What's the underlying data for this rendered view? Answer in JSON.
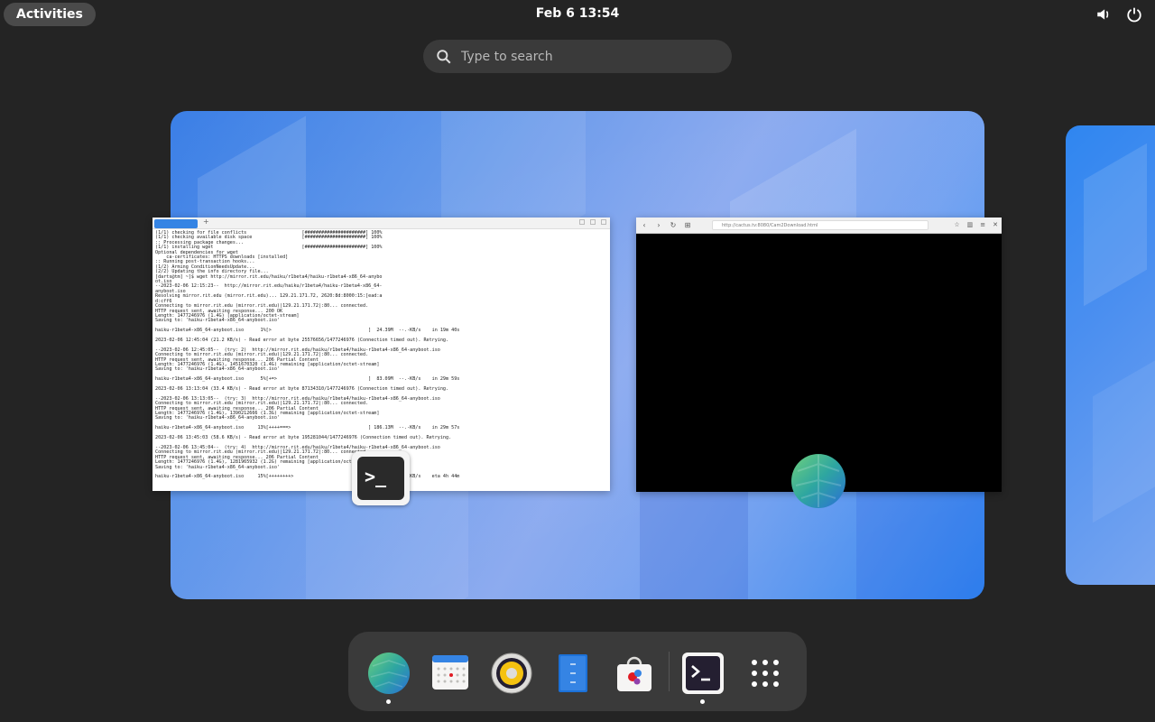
{
  "topbar": {
    "activities_label": "Activities",
    "clock": "Feb 6  13:54",
    "volume_icon": "volume-icon",
    "power_icon": "power-icon"
  },
  "search": {
    "placeholder": "Type to search"
  },
  "terminal_window": {
    "app_icon": "terminal-icon",
    "lines": [
      "(1/1) checking for file conflicts                    [######################] 100%",
      "(1/1) checking available disk space                  [######################] 100%",
      ":: Processing package changes...",
      "(1/1) installing wget                                [######################] 100%",
      "Optional dependencies for wget",
      "    ca-certificates: HTTPS downloads [installed]",
      ":: Running post-transaction hooks...",
      "(1/2) Arming ConditionNeedsUpdate...",
      "(2/2) Updating the info directory file...",
      "[darts@tm] ~]$ wget http://mirror.rit.edu/haiku/r1beta4/haiku-r1beta4-x86_64-anybo",
      "ot.iso",
      "--2023-02-06 12:15:23--  http://mirror.rit.edu/haiku/r1beta4/haiku-r1beta4-x86_64-",
      "anyboot.iso",
      "Resolving mirror.rit.edu (mirror.rit.edu)... 129.21.171.72, 2620:8d:8000:15:[ead:a",
      "d:cff6",
      "Connecting to mirror.rit.edu (mirror.rit.edu)|129.21.171.72|:80... connected.",
      "HTTP request sent, awaiting response... 200 OK",
      "Length: 1477246976 (1.4G) [application/octet-stream]",
      "Saving to: 'haiku-r1beta4-x86_64-anyboot.iso'",
      "",
      "haiku-r1beta4-x86_64-anyboot.iso      1%[>                                   ]  24.39M  --.-KB/s    in 19m 40s",
      "",
      "2023-02-06 12:45:04 (21.2 KB/s) - Read error at byte 25576656/1477246976 (Connection timed out). Retrying.",
      "",
      "--2023-02-06 12:45:05--  (try: 2)  http://mirror.rit.edu/haiku/r1beta4/haiku-r1beta4-x86_64-anyboot.iso",
      "Connecting to mirror.rit.edu (mirror.rit.edu)|129.21.171.72|:80... connected.",
      "HTTP request sent, awaiting response... 206 Partial Content",
      "Length: 1477246976 (1.4G), 1451670320 (1.4G) remaining [application/octet-stream]",
      "Saving to: 'haiku-r1beta4-x86_64-anyboot.iso'",
      "",
      "haiku-r1beta4-x86_64-anyboot.iso      5%[+=>                                 ]  83.09M  --.-KB/s    in 29m 59s",
      "",
      "2023-02-06 13:13:04 (33.4 KB/s) - Read error at byte 87134310/1477246976 (Connection timed out). Retrying.",
      "",
      "--2023-02-06 13:13:05--  (try: 3)  http://mirror.rit.edu/haiku/r1beta4/haiku-r1beta4-x86_64-anyboot.iso",
      "Connecting to mirror.rit.edu (mirror.rit.edu)|129.21.171.72|:80... connected.",
      "HTTP request sent, awaiting response... 206 Partial Content",
      "Length: 1477246976 (1.4G), 1390212666 (1.3G) remaining [application/octet-stream]",
      "Saving to: 'haiku-r1beta4-x86_64-anyboot.iso'",
      "",
      "haiku-r1beta4-x86_64-anyboot.iso     13%[++++===>                            ] 186.13M  --.-KB/s    in 29m 57s",
      "",
      "2023-02-06 13:45:03 (58.6 KB/s) - Read error at byte 195281044/1477246976 (Connection timed out). Retrying.",
      "",
      "--2023-02-06 13:45:04--  (try: 4)  http://mirror.rit.edu/haiku/r1beta4/haiku-r1beta4-x86_64-anyboot.iso",
      "Connecting to mirror.rit.edu (mirror.rit.edu)|129.21.171.72|:80... connected.",
      "HTTP request sent, awaiting response... 206 Partial Content",
      "Length: 1477246976 (1.4G), 1281965932 (1.2G) remaining [application/octet-stream]",
      "Saving to: 'haiku-r1beta4-x86_64-anyboot.iso'",
      "",
      "haiku-r1beta4-x86_64-anyboot.iso     15%[++++++++>                           ] 212.61M  57.2KB/s    eta 4h 44m"
    ]
  },
  "browser_window": {
    "url": "http://cactus.tv:8080/Cam2Download.html",
    "app_icon": "web-browser-icon"
  },
  "dock": {
    "items": [
      {
        "name": "web-browser",
        "icon": "globe-icon",
        "running": true
      },
      {
        "name": "calendar",
        "icon": "calendar-icon",
        "running": false
      },
      {
        "name": "rhythmbox",
        "icon": "speaker-icon",
        "running": false
      },
      {
        "name": "text-editor",
        "icon": "notepad-icon",
        "running": false
      },
      {
        "name": "software",
        "icon": "shopping-bag-icon",
        "running": false
      },
      {
        "name": "terminal",
        "icon": "terminal-icon",
        "running": true
      },
      {
        "name": "show-apps",
        "icon": "app-grid-icon",
        "running": false
      }
    ]
  },
  "colors": {
    "accent": "#3584e4",
    "panel": "#242424",
    "dock": "#3a3a3a"
  }
}
